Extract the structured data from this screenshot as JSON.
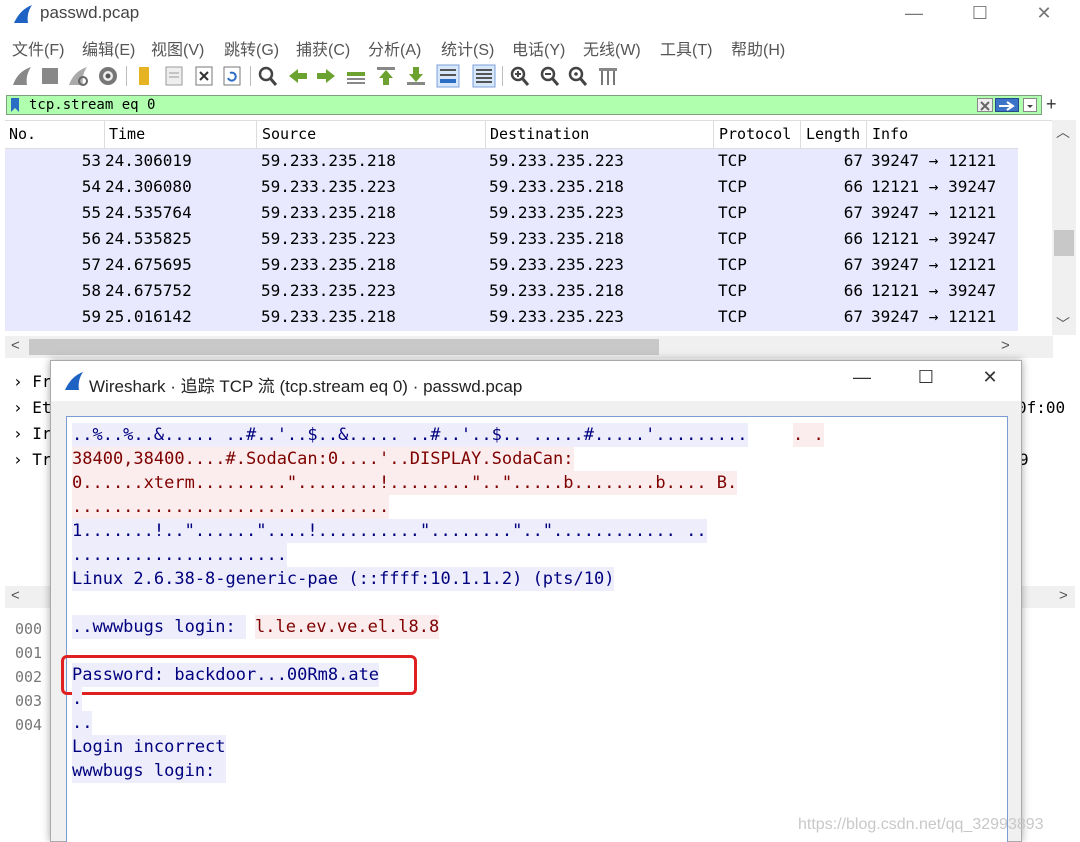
{
  "window": {
    "title": "passwd.pcap",
    "minimize": "—",
    "maximize": "☐",
    "close": "✕"
  },
  "menu": [
    "文件(F)",
    "编辑(E)",
    "视图(V)",
    "跳转(G)",
    "捕获(C)",
    "分析(A)",
    "统计(S)",
    "电话(Y)",
    "无线(W)",
    "工具(T)",
    "帮助(H)"
  ],
  "filter": {
    "value": "tcp.stream eq 0",
    "plus": "+"
  },
  "packet_list": {
    "columns": [
      "No.",
      "Time",
      "Source",
      "Destination",
      "Protocol",
      "Length",
      "Info"
    ],
    "rows": [
      {
        "no": "53",
        "time": "24.306019",
        "src": "59.233.235.218",
        "dst": "59.233.235.223",
        "proto": "TCP",
        "len": "67",
        "info": "39247 → 12121"
      },
      {
        "no": "54",
        "time": "24.306080",
        "src": "59.233.235.223",
        "dst": "59.233.235.218",
        "proto": "TCP",
        "len": "66",
        "info": "12121 → 39247"
      },
      {
        "no": "55",
        "time": "24.535764",
        "src": "59.233.235.218",
        "dst": "59.233.235.223",
        "proto": "TCP",
        "len": "67",
        "info": "39247 → 12121"
      },
      {
        "no": "56",
        "time": "24.535825",
        "src": "59.233.235.223",
        "dst": "59.233.235.218",
        "proto": "TCP",
        "len": "66",
        "info": "12121 → 39247"
      },
      {
        "no": "57",
        "time": "24.675695",
        "src": "59.233.235.218",
        "dst": "59.233.235.223",
        "proto": "TCP",
        "len": "67",
        "info": "39247 → 12121"
      },
      {
        "no": "58",
        "time": "24.675752",
        "src": "59.233.235.223",
        "dst": "59.233.235.218",
        "proto": "TCP",
        "len": "66",
        "info": "12121 → 39247"
      },
      {
        "no": "59",
        "time": "25.016142",
        "src": "59.233.235.218",
        "dst": "59.233.235.223",
        "proto": "TCP",
        "len": "67",
        "info": "39247 → 12121"
      }
    ]
  },
  "details": {
    "tree_items": [
      "Fr",
      "Et",
      "Ir",
      "Tr"
    ],
    "peek_hex": "0f:00",
    "peek_tail": "9"
  },
  "bytes": {
    "offsets": [
      "000",
      "001",
      "002",
      "003",
      "004"
    ]
  },
  "stream_dialog": {
    "title": "Wireshark · 追踪 TCP 流 (tcp.stream eq 0) · passwd.pcap",
    "minimize": "—",
    "maximize": "☐",
    "close": "✕",
    "lines": {
      "l0a": "..%..%..&..... ..#..'..$..&..... ..#..'..$.. .....#.....'.........",
      "l0b": ". .",
      "l1": "38400,38400....#.SodaCan:0....'..DISPLAY.SodaCan:",
      "l2": "0......xterm.........\"........!........\"..\".....b........b.... B.",
      "l3": "...............................",
      "l4": "1.......!..\"......\"....!..........\"........\"..\"............ ..",
      "l5": ".....................",
      "l6": "Linux 2.6.38-8-generic-pae (::ffff:10.1.1.2) (pts/10)",
      "l7a": "..wwwbugs login: ",
      "l7b": "l.le.ev.ve.el.l8.8",
      "l8": "Password: backdoor...00Rm8.ate",
      "l9": ".",
      "l10": "..",
      "l11": "Login incorrect",
      "l12": "wwwbugs login: "
    }
  },
  "watermark": "https://blog.csdn.net/qq_32993893"
}
